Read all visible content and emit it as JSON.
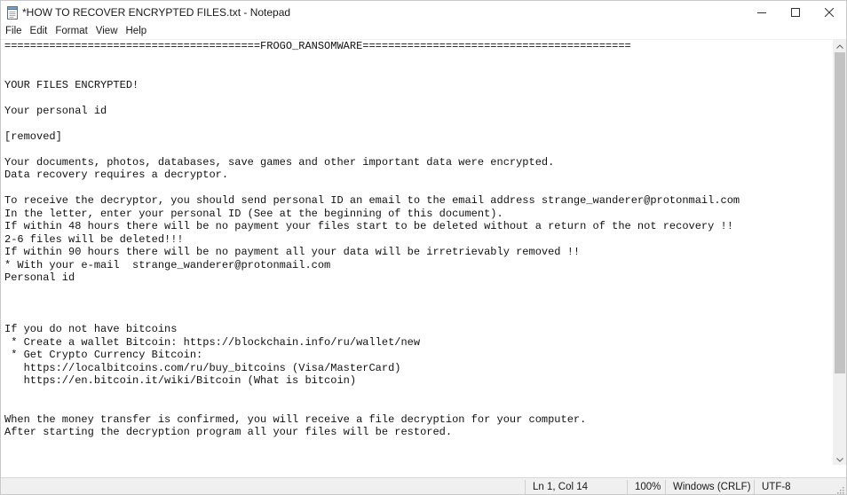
{
  "window": {
    "title": "*HOW TO RECOVER ENCRYPTED FILES.txt - Notepad",
    "icons": {
      "app": "notepad-icon",
      "minimize": "minimize-icon",
      "maximize": "maximize-icon",
      "close": "close-icon"
    }
  },
  "menu": {
    "items": [
      "File",
      "Edit",
      "Format",
      "View",
      "Help"
    ]
  },
  "document": {
    "lines": [
      "========================================FROGO_RANSOMWARE==========================================",
      "",
      "",
      "YOUR FILES ENCRYPTED!",
      "",
      "Your personal id",
      "",
      "[removed]",
      "",
      "Your documents, photos, databases, save games and other important data were encrypted.",
      "Data recovery requires a decryptor.",
      "",
      "To receive the decryptor, you should send personal ID an email to the email address strange_wanderer@protonmail.com",
      "In the letter, enter your personal ID (See at the beginning of this document).",
      "If within 48 hours there will be no payment your files start to be deleted without a return of the not recovery !!",
      "2-6 files will be deleted!!!",
      "If within 90 hours there will be no payment all your data will be irretrievably removed !!",
      "* With your e-mail  strange_wanderer@protonmail.com",
      "Personal id",
      "",
      "",
      "",
      "If you do not have bitcoins",
      " * Create a wallet Bitcoin: https://blockchain.info/ru/wallet/new",
      " * Get Crypto Currency Bitcoin:",
      "   https://localbitcoins.com/ru/buy_bitcoins (Visa/MasterCard)",
      "   https://en.bitcoin.it/wiki/Bitcoin (What is bitcoin)",
      "",
      "",
      "When the money transfer is confirmed, you will receive a file decryption for your computer.",
      "After starting the decryption program all your files will be restored."
    ]
  },
  "scrollbar": {
    "icons": {
      "up": "scroll-up-arrow-icon",
      "down": "scroll-down-arrow-icon"
    }
  },
  "status": {
    "position": "Ln 1, Col 14",
    "zoom": "100%",
    "line_ending": "Windows (CRLF)",
    "encoding": "UTF-8"
  },
  "colors": {
    "scroll_track": "#f0f0f0",
    "scroll_thumb": "#c2c2c2",
    "status_bg": "#f0f0f0"
  }
}
